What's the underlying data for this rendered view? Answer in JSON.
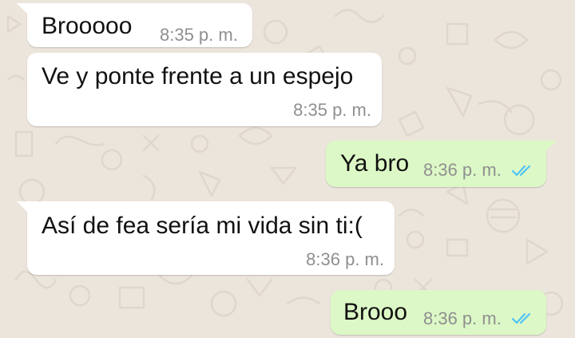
{
  "chat": {
    "messages": [
      {
        "direction": "incoming",
        "text": "Brooooo",
        "time": "8:35 p. m."
      },
      {
        "direction": "incoming",
        "text": "Ve y ponte frente a un espejo",
        "time": "8:35 p. m."
      },
      {
        "direction": "outgoing",
        "text": "Ya bro",
        "time": "8:36 p. m.",
        "status": "read"
      },
      {
        "direction": "incoming",
        "text": "Así de fea sería mi vida sin ti:(",
        "time": "8:36 p. m."
      },
      {
        "direction": "outgoing",
        "text": "Brooo",
        "time": "8:36 p. m.",
        "status": "read"
      }
    ]
  },
  "colors": {
    "wallpaper": "#ece5dc",
    "incoming_bubble": "#ffffff",
    "outgoing_bubble": "#dcf8c6",
    "time_text": "#8f8f8f",
    "read_ticks": "#4fc3f7"
  },
  "icons": {
    "read_receipt": "double-check-icon"
  }
}
